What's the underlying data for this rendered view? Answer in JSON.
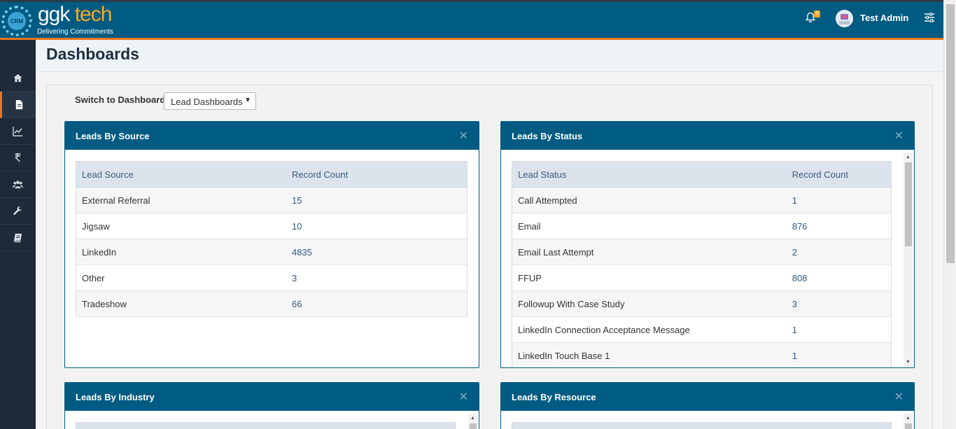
{
  "brand": {
    "part1": "ggk",
    "part2": " tech",
    "tagline": "Delivering Commitments",
    "gear_text": "CRM"
  },
  "header": {
    "notification_count": "0",
    "user_name": "Test Admin"
  },
  "sidebar": {
    "items": [
      {
        "icon": "home-icon"
      },
      {
        "icon": "document-icon",
        "active": true
      },
      {
        "icon": "line-chart-icon"
      },
      {
        "icon": "rupee-icon"
      },
      {
        "icon": "users-icon"
      },
      {
        "icon": "wrench-icon"
      },
      {
        "icon": "book-icon"
      }
    ]
  },
  "page": {
    "title": "Dashboards"
  },
  "switcher": {
    "label": "Switch to Dashboard:",
    "selected": "Lead Dashboards"
  },
  "widgets": {
    "source": {
      "title": "Leads By Source",
      "close": "✕",
      "headers": [
        "Lead Source",
        "Record Count"
      ],
      "rows": [
        [
          "External Referral",
          "15"
        ],
        [
          "Jigsaw",
          "10"
        ],
        [
          "LinkedIn",
          "4835"
        ],
        [
          "Other",
          "3"
        ],
        [
          "Tradeshow",
          "66"
        ]
      ]
    },
    "status": {
      "title": "Leads By Status",
      "close": "✕",
      "headers": [
        "Lead Status",
        "Record Count"
      ],
      "rows": [
        [
          "Call Attempted",
          "1"
        ],
        [
          "Email",
          "876"
        ],
        [
          "Email Last Attempt",
          "2"
        ],
        [
          "FFUP",
          "808"
        ],
        [
          "Followup With Case Study",
          "3"
        ],
        [
          "LinkedIn Connection Acceptance Message",
          "1"
        ],
        [
          "LinkedIn Touch Base 1",
          "1"
        ]
      ]
    },
    "industry": {
      "title": "Leads By Industry",
      "close": "✕"
    },
    "resource": {
      "title": "Leads By Resource",
      "close": "✕"
    }
  },
  "colors": {
    "primary": "#005b82",
    "accent": "#e8761e",
    "sidebar": "#1e2a38",
    "brand_gold": "#f7a823"
  }
}
